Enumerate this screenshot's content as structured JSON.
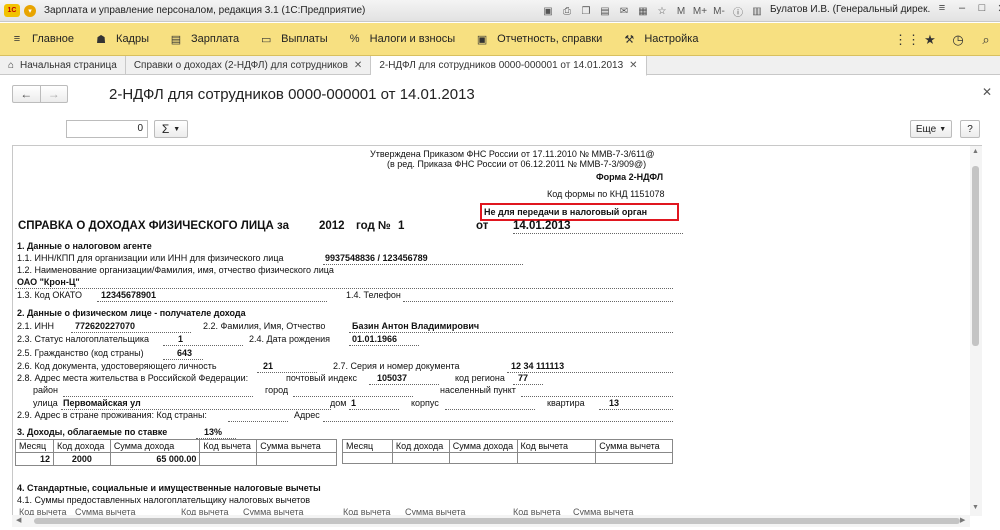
{
  "window": {
    "logo": "1С",
    "title": "Зарплата и управление персоналом, редакция 3.1  (1С:Предприятие)",
    "user": "Булатов И.В. (Генеральный дирек...",
    "toolbar_icons": [
      "save-icon",
      "print-icon",
      "copy-icon",
      "paste-icon",
      "mail-icon",
      "grid-icon",
      "star-icon",
      "M",
      "M+",
      "M-",
      "info-icon",
      "tiles-icon"
    ]
  },
  "menu": {
    "items": [
      {
        "icon": "≡",
        "label": "Главное"
      },
      {
        "icon": "☗",
        "label": "Кадры"
      },
      {
        "icon": "▤",
        "label": "Зарплата"
      },
      {
        "icon": "▭",
        "label": "Выплаты"
      },
      {
        "icon": "%",
        "label": "Налоги и взносы"
      },
      {
        "icon": "▣",
        "label": "Отчетность, справки"
      },
      {
        "icon": "⚒",
        "label": "Настройка"
      }
    ],
    "right_icons": [
      "apps-icon",
      "star-icon",
      "history-icon",
      "search-icon"
    ]
  },
  "tabs": [
    {
      "label": "Начальная страница",
      "closable": false,
      "active": false
    },
    {
      "label": "Справки о доходах (2-НДФЛ) для сотрудников",
      "closable": true,
      "active": false
    },
    {
      "label": "2-НДФЛ для сотрудников 0000-000001 от 14.01.2013",
      "closable": true,
      "active": true
    }
  ],
  "form": {
    "title": "2-НДФЛ для сотрудников 0000-000001 от 14.01.2013",
    "number_value": "0",
    "more_label": "Еще",
    "help_label": "?"
  },
  "doc": {
    "approved1": "Утверждена Приказом ФНС России от 17.11.2010 № ММВ-7-3/611@",
    "approved2": "(в ред. Приказа ФНС России от 06.12.2011 № ММВ-7-3/909@)",
    "form_name": "Форма 2-НДФЛ",
    "knd": "Код формы по КНД 1151078",
    "not_for_tax": "Не для передачи в налоговый орган",
    "heading": "СПРАВКА О ДОХОДАХ ФИЗИЧЕСКОГО ЛИЦА за",
    "year": "2012",
    "year_label": "год №",
    "number": "1",
    "from_label": "от",
    "date": "14.01.2013",
    "s1": "1. Данные о налоговом агенте",
    "s11": "1.1. ИНН/КПП для организации или ИНН для физического лица",
    "s11v": "9937548836 / 123456789",
    "s12": "1.2. Наименование организации/Фамилия, имя, отчество физического лица",
    "s12v": "ОАО \"Крон-Ц\"",
    "s13": "1.3. Код ОКАТО",
    "s13v": "12345678901",
    "s14": "1.4. Телефон",
    "s2": "2. Данные о физическом лице - получателе дохода",
    "s21": "2.1. ИНН",
    "s21v": "772620227070",
    "s22": "2.2. Фамилия, Имя, Отчество",
    "s22v": "Базин Антон Владимирович",
    "s23": "2.3. Статус налогоплательщика",
    "s23v": "1",
    "s24": "2.4. Дата рождения",
    "s24v": "01.01.1966",
    "s25": "2.5. Гражданство (код страны)",
    "s25v": "643",
    "s26": "2.6. Код документа, удостоверяющего личность",
    "s26v": "21",
    "s27": "2.7. Серия и номер документа",
    "s27v": "12 34 111113",
    "s28": "2.8. Адрес места жительства в Российской Федерации:",
    "postal": "почтовый индекс",
    "postal_v": "105037",
    "region": "код региона",
    "region_v": "77",
    "district": "район",
    "city": "город",
    "settlement": "населенный пункт",
    "street": "улица",
    "street_v": "Первомайская ул",
    "house": "дом",
    "house_v": "1",
    "building": "корпус",
    "flat": "квартира",
    "flat_v": "13",
    "s29": "2.9. Адрес в стране проживания: Код страны:",
    "s29addr": "Адрес",
    "s3": "3. Доходы, облагаемые по ставке",
    "rate": "13%",
    "table_headers": [
      "Месяц",
      "Код дохода",
      "Сумма дохода",
      "Код вычета",
      "Сумма вычета"
    ],
    "income_rows": [
      {
        "month": "12",
        "code": "2000",
        "sum": "65 000.00",
        "ded_code": "",
        "ded_sum": ""
      }
    ],
    "s4": "4. Стандартные, социальные и имущественные налоговые вычеты",
    "s41": "4.1. Суммы предоставленных налогоплательщику налоговых вычетов",
    "bottom_headers": [
      "Код вычета",
      "Сумма вычета",
      "Код вычета",
      "Сумма вычета",
      "Код вычета",
      "Сумма вычета",
      "Код вычета",
      "Сумма вычета"
    ]
  }
}
